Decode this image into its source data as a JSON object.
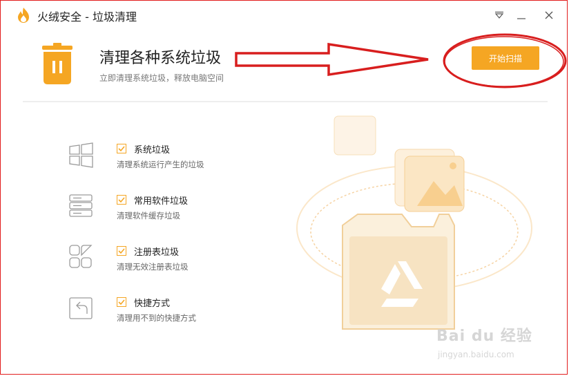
{
  "window": {
    "title": "火绒安全 - 垃圾清理"
  },
  "header": {
    "title": "清理各种系统垃圾",
    "subtitle": "立即清理系统垃圾，释放电脑空间",
    "start_button": "开始扫描"
  },
  "categories": [
    {
      "title": "系统垃圾",
      "desc": "清理系统运行产生的垃圾",
      "checked": true,
      "icon": "windows-icon"
    },
    {
      "title": "常用软件垃圾",
      "desc": "清理软件缓存垃圾",
      "checked": true,
      "icon": "server-icon"
    },
    {
      "title": "注册表垃圾",
      "desc": "清理无效注册表垃圾",
      "checked": true,
      "icon": "grid-icon"
    },
    {
      "title": "快捷方式",
      "desc": "清理用不到的快捷方式",
      "checked": true,
      "icon": "shortcut-icon"
    }
  ],
  "watermark": {
    "brand": "Bai du 经验",
    "url": "jingyan.baidu.com"
  },
  "colors": {
    "accent": "#f5a623",
    "annotation": "#d81e1e"
  }
}
